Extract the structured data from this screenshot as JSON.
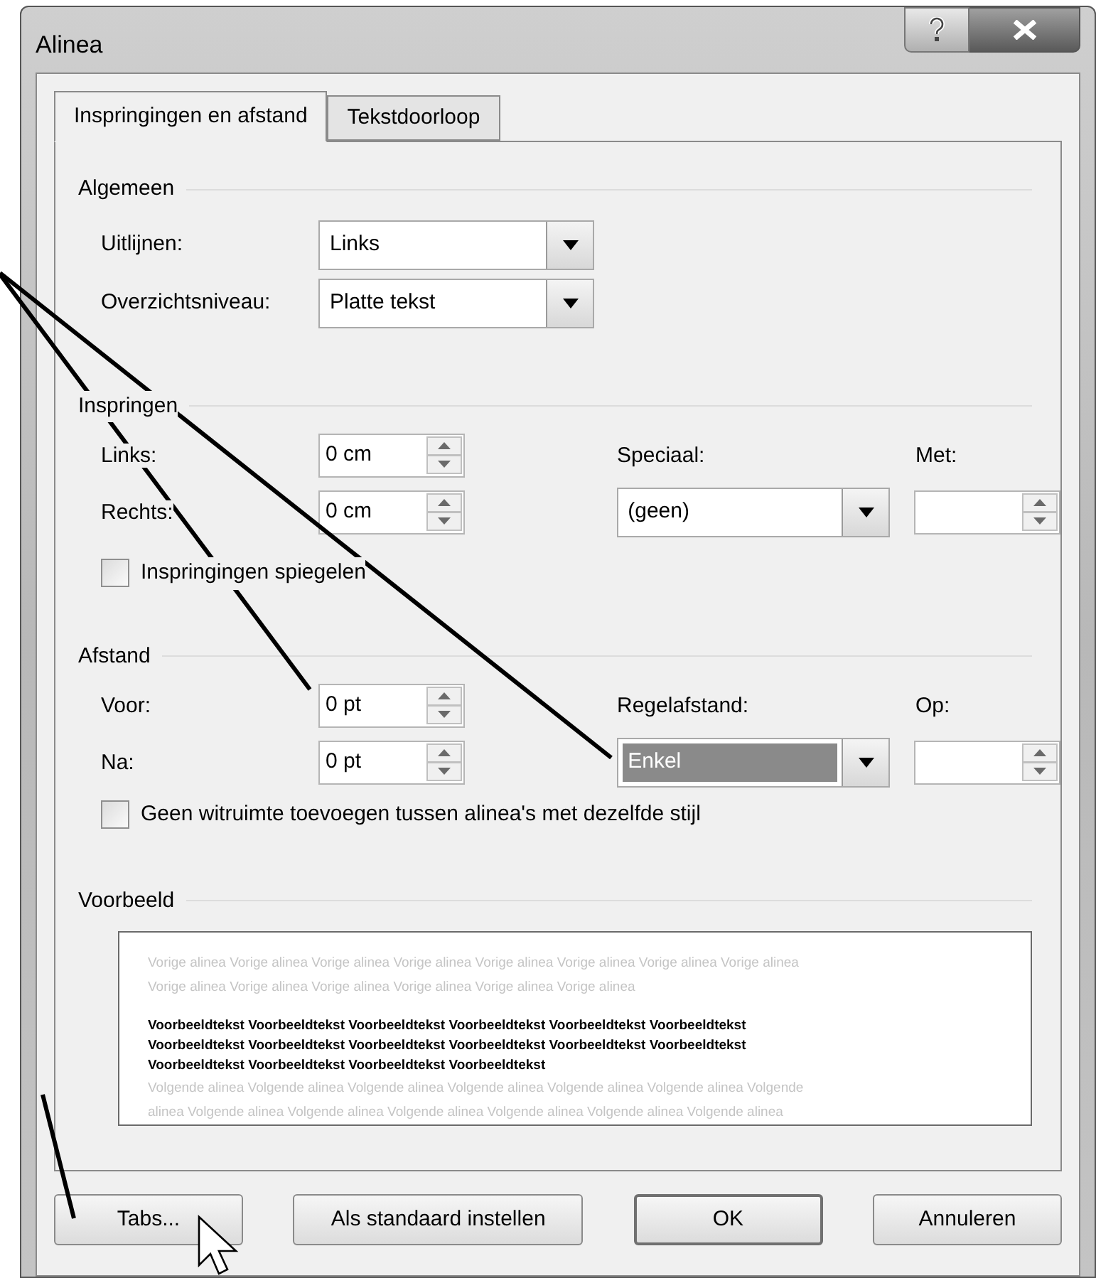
{
  "window": {
    "title": "Alinea"
  },
  "tabs": [
    {
      "label": "Inspringingen en afstand",
      "selected": true
    },
    {
      "label": "Tekstdoorloop",
      "selected": false
    }
  ],
  "general": {
    "title": "Algemeen",
    "rows": [
      {
        "label": "Uitlijnen:",
        "value": "Links"
      },
      {
        "label": "Overzichtsniveau:",
        "value": "Platte tekst"
      }
    ]
  },
  "indentation": {
    "title": "Inspringen",
    "left": {
      "label": "Links:",
      "value": "0 cm"
    },
    "right": {
      "label": "Rechts:",
      "value": "0 cm"
    },
    "special": {
      "label": "Speciaal:",
      "value": "(geen)"
    },
    "by": {
      "label": "Met:"
    },
    "mirror": {
      "label": "Inspringingen spiegelen",
      "checked": false
    }
  },
  "spacing": {
    "title": "Afstand",
    "before": {
      "label": "Voor:",
      "value": "0 pt"
    },
    "after": {
      "label": "Na:",
      "value": "0 pt"
    },
    "line_spacing": {
      "label": "Regelafstand:",
      "value": "Enkel",
      "selected": true
    },
    "at": {
      "label": "Op:"
    },
    "no_space": {
      "label": "Geen witruimte toevoegen tussen alinea's met dezelfde stijl",
      "checked": false
    }
  },
  "preview": {
    "title": "Voorbeeld",
    "previous": [
      "Vorige alinea Vorige alinea Vorige alinea Vorige alinea Vorige alinea Vorige alinea Vorige alinea Vorige alinea",
      "Vorige alinea Vorige alinea Vorige alinea Vorige alinea Vorige alinea Vorige alinea"
    ],
    "sample": [
      "Voorbeeldtekst Voorbeeldtekst Voorbeeldtekst Voorbeeldtekst Voorbeeldtekst Voorbeeldtekst",
      "Voorbeeldtekst Voorbeeldtekst Voorbeeldtekst Voorbeeldtekst Voorbeeldtekst Voorbeeldtekst",
      "Voorbeeldtekst Voorbeeldtekst Voorbeeldtekst Voorbeeldtekst"
    ],
    "next": [
      "Volgende alinea Volgende alinea Volgende alinea Volgende alinea Volgende alinea Volgende alinea Volgende",
      "alinea Volgende alinea Volgende alinea Volgende alinea Volgende alinea Volgende alinea Volgende alinea"
    ]
  },
  "buttons": [
    {
      "label": "Tabs...",
      "default": false
    },
    {
      "label": "Als standaard instellen",
      "default": false
    },
    {
      "label": "OK",
      "default": true
    },
    {
      "label": "Annuleren",
      "default": false
    }
  ]
}
